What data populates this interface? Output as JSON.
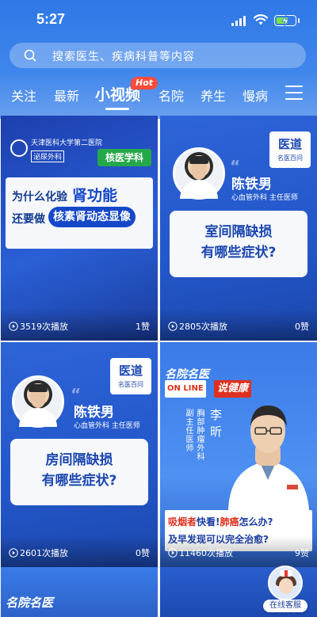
{
  "status_bar": {
    "time": "5:27"
  },
  "search": {
    "placeholder": "搜索医生、疾病科普等内容"
  },
  "tabs": [
    {
      "label": "关注"
    },
    {
      "label": "最新"
    },
    {
      "label": "小视频",
      "active": true,
      "badge": "Hot"
    },
    {
      "label": "名院"
    },
    {
      "label": "养生"
    },
    {
      "label": "慢病"
    }
  ],
  "colors": {
    "brand_blue": "#2f78e6",
    "hot_red": "#ff4d3a",
    "dept_green": "#25a84a"
  },
  "videos": [
    {
      "hospital_line1": "天津医科大学第二医院",
      "hospital_line2": "泌尿外科",
      "department_tag": "核医学科",
      "title_prefix": "为什么化验",
      "title_highlight": "肾功能",
      "title_line2_prefix": "还要做",
      "title_line2_highlight": "核素肾动态显像",
      "plays": "3519次播放",
      "likes": "1赞"
    },
    {
      "brand_big": "医道",
      "brand_small": "名医百问",
      "doctor_name": "陈铁男",
      "doctor_title": "心血管外科 主任医师",
      "question_line1": "室间隔缺损",
      "question_line2": "有哪些症状?",
      "plays": "2805次播放",
      "likes": "0赞"
    },
    {
      "brand_big": "医道",
      "brand_small": "名医百问",
      "doctor_name": "陈铁男",
      "doctor_title": "心血管外科 主任医师",
      "question_line1": "房间隔缺损",
      "question_line2": "有哪些症状?",
      "plays": "2601次播放",
      "likes": "0赞"
    },
    {
      "logo_top": "名院名医",
      "logo_online": "ON LINE",
      "logo_talk": "说健康",
      "doctor_dept": "胸部肿瘤外科",
      "doctor_role": "副主任医师",
      "doctor_name": "李昕",
      "caption_red1": "吸烟者",
      "caption_part1": "快看!",
      "caption_red2": "肺癌",
      "caption_part2": "怎么办?",
      "caption_line2": "及早发现可以完全治愈?",
      "plays": "11460次播放",
      "likes": "9赞"
    }
  ],
  "peek_left_logo": "名院名医",
  "online_service": {
    "label": "在线客服"
  }
}
